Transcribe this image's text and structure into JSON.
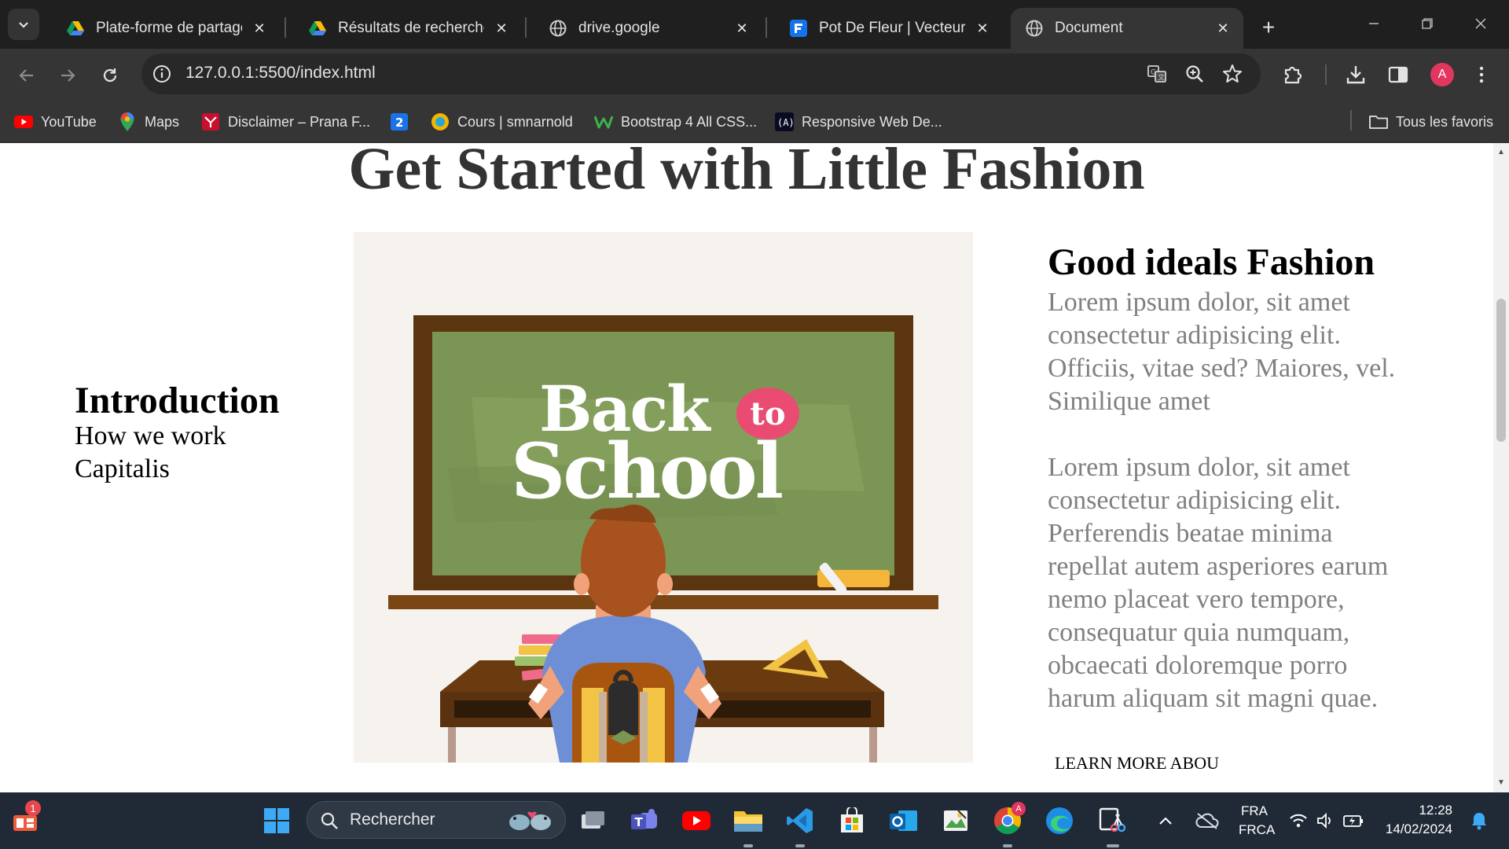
{
  "browser": {
    "tabs": [
      {
        "title": "Plate-forme de partage d",
        "icon": "google-drive-icon"
      },
      {
        "title": "Résultats de recherche -",
        "icon": "google-drive-icon"
      },
      {
        "title": "drive.google",
        "icon": "globe-icon"
      },
      {
        "title": "Pot De Fleur | Vecteurs et",
        "icon": "freepik-icon"
      },
      {
        "title": "Document",
        "icon": "globe-icon",
        "active": true
      }
    ],
    "url": "127.0.0.1:5500/index.html",
    "profile_initial": "A",
    "bookmarks": [
      {
        "label": "YouTube",
        "icon": "youtube-icon"
      },
      {
        "label": "Maps",
        "icon": "maps-icon"
      },
      {
        "label": "Disclaimer – Prana F...",
        "icon": "prana-icon"
      },
      {
        "label": "",
        "icon": "number-2-icon"
      },
      {
        "label": "Cours | smnarnold",
        "icon": "smn-icon"
      },
      {
        "label": "Bootstrap 4 All CSS...",
        "icon": "w-icon"
      },
      {
        "label": "Responsive Web De...",
        "icon": "fcc-icon"
      }
    ],
    "all_bookmarks": "Tous les favoris"
  },
  "page": {
    "title": "Get Started with Little Fashion",
    "left": {
      "heading": "Introduction",
      "links": [
        "How we work",
        "Capitalis"
      ]
    },
    "image": {
      "word1": "Back",
      "word2": "to",
      "word3": "School"
    },
    "right": {
      "heading": "Good ideals Fashion",
      "para1": "Lorem ipsum dolor, sit amet consectetur adipisicing elit. Officiis, vitae sed? Maiores, vel. Similique amet",
      "para2": "Lorem ipsum dolor, sit amet consectetur adipisicing elit. Perferendis beatae minima repellat autem asperiores earum nemo placeat vero tempore, consequatur quia numquam, obcaecati doloremque porro harum aliquam sit magni quae.",
      "learn_more": "LEARN MORE ABOU"
    }
  },
  "taskbar": {
    "search_placeholder": "Rechercher",
    "widgets_badge": "1",
    "lang_top": "FRA",
    "lang_bottom": "FRCA",
    "time": "12:28",
    "date": "14/02/2024",
    "chrome_badge": "A"
  },
  "colors": {
    "chalkboard": "#7b9654",
    "board_frame": "#5a3510",
    "accent_pink": "#e94b72"
  }
}
